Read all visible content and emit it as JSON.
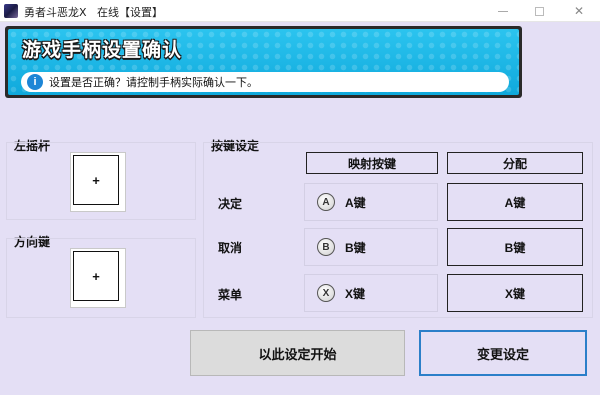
{
  "window": {
    "title": "勇者斗恶龙X   在线【设置】",
    "close_glyph": "✕"
  },
  "banner": {
    "title": "游戏手柄设置确认",
    "info_glyph": "i",
    "message": "设置是否正确？请控制手柄实际确认一下。"
  },
  "left_stick": {
    "label": "左摇杆",
    "indicator": "+"
  },
  "dpad": {
    "label": "方向键",
    "indicator": "+"
  },
  "key_settings": {
    "label": "按键设定",
    "col_mapped": "映射按键",
    "col_assign": "分配",
    "rows": [
      {
        "label": "决定",
        "button_glyph": "A",
        "mapped": "A键",
        "assign": "A键"
      },
      {
        "label": "取消",
        "button_glyph": "B",
        "mapped": "B键",
        "assign": "B键"
      },
      {
        "label": "菜单",
        "button_glyph": "X",
        "mapped": "X键",
        "assign": "X键"
      }
    ]
  },
  "footer": {
    "start_label": "以此设定开始",
    "change_label": "变更设定"
  },
  "colors": {
    "background": "#e4dff5",
    "banner": "#1ab3e6",
    "accent_border": "#2b7fc9"
  }
}
